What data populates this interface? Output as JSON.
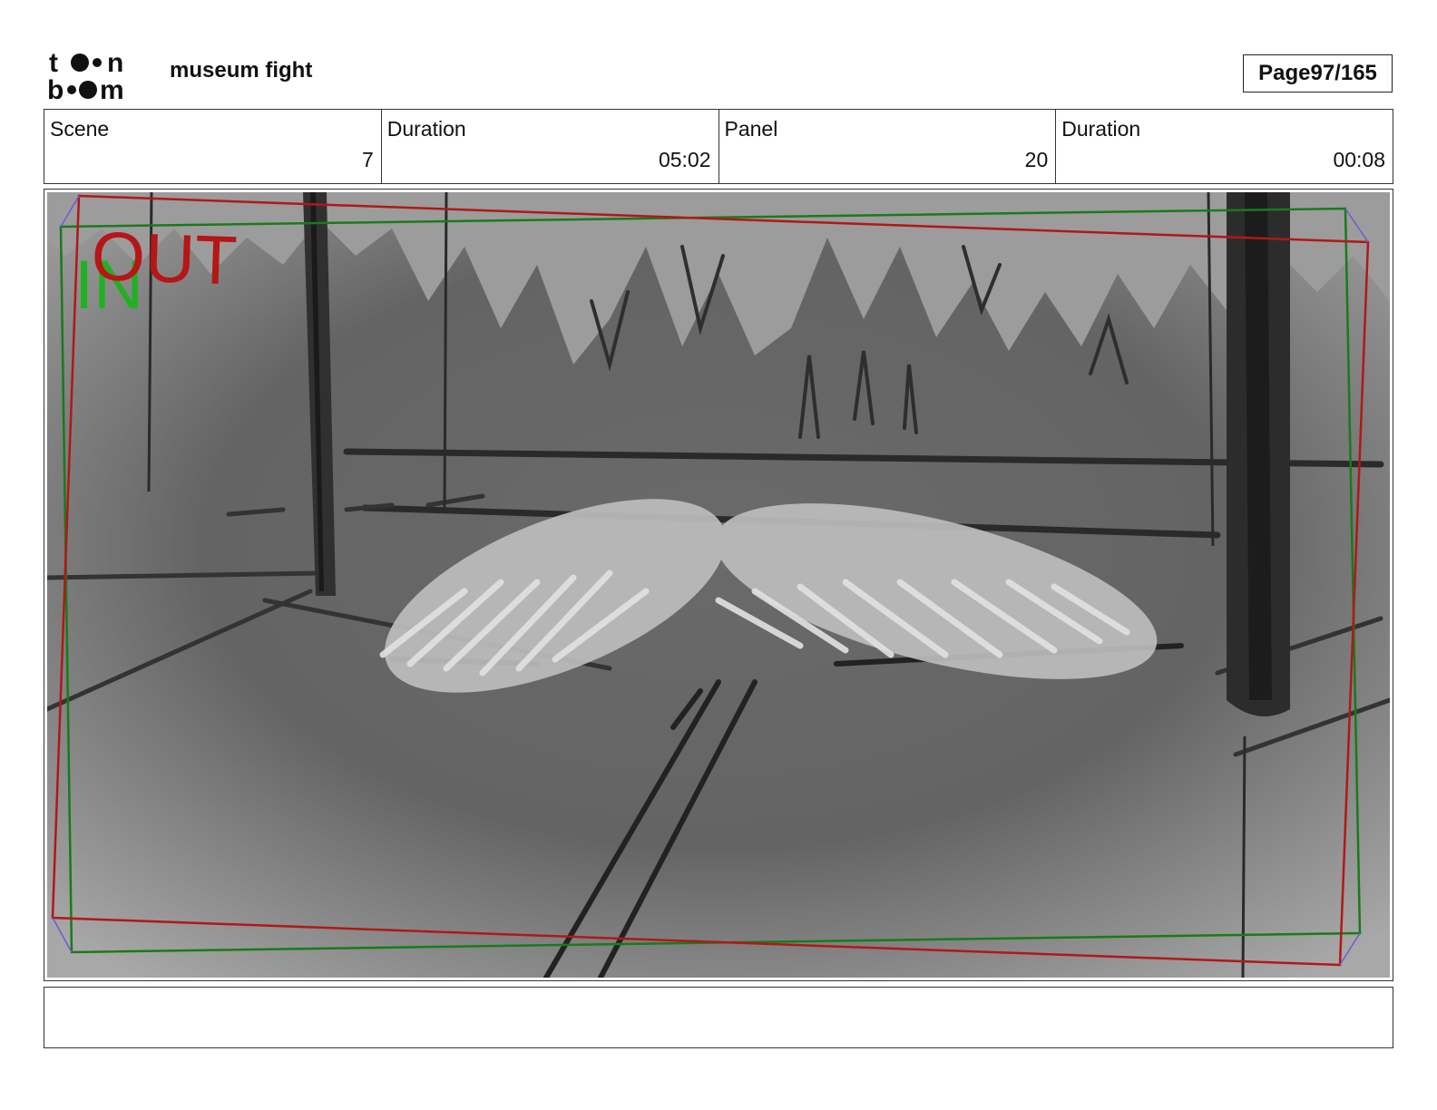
{
  "header": {
    "project_title": "museum fight",
    "page_label": "Page",
    "page_number": "97/165"
  },
  "info": {
    "scene": {
      "label": "Scene",
      "value": "7"
    },
    "scene_duration": {
      "label": "Duration",
      "value": "05:02"
    },
    "panel": {
      "label": "Panel",
      "value": "20"
    },
    "panel_duration": {
      "label": "Duration",
      "value": "00:08"
    }
  },
  "panel_image": {
    "in_label": "IN",
    "out_label": "OUT"
  },
  "notes": {
    "text": ""
  },
  "colors": {
    "in_frame": "#1a7a1a",
    "out_frame": "#b01818",
    "in_text": "#22b022",
    "out_text": "#b51616"
  }
}
